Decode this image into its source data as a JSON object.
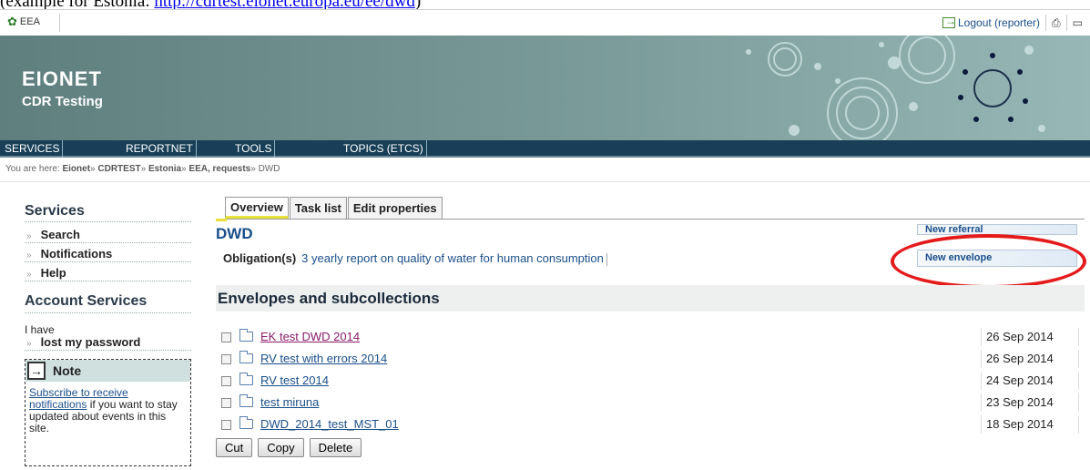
{
  "doc_caption": {
    "prefix": "(example for Estonia: ",
    "link": "http://cdrtest.eionet.europa.eu/ee/dwd",
    "suffix": ")"
  },
  "topbar": {
    "logo": "EEA",
    "logout": "Logout (reporter)",
    "icons": [
      "logout-icon",
      "print-icon",
      "fullscreen-icon"
    ]
  },
  "banner": {
    "brand": "EIONET",
    "subtitle": "CDR Testing"
  },
  "nav": [
    "SERVICES",
    "REPORTNET",
    "TOOLS",
    "TOPICS (ETCS)"
  ],
  "breadcrumb": {
    "prefix": "You are here:",
    "items": [
      "Eionet",
      "CDRTEST",
      "Estonia",
      "EEA, requests",
      "DWD"
    ]
  },
  "left": {
    "services_heading": "Services",
    "services": [
      "Search",
      "Notifications",
      "Help"
    ],
    "account_heading": "Account Services",
    "i_have": "I have",
    "lost_password": "lost my password",
    "note": {
      "title": "Note",
      "link": "Subscribe to receive notifications",
      "text": " if you want to stay updated about events in this site."
    }
  },
  "tabs": [
    "Overview",
    "Task list",
    "Edit properties"
  ],
  "main": {
    "title": "DWD",
    "obligation_label": "Obligation(s)",
    "obligation_link": "3 yearly report on quality of water for human consumption",
    "new_referral": "New referral",
    "new_envelope": "New envelope",
    "section_title": "Envelopes and subcollections"
  },
  "envelopes": [
    {
      "name": "EK test DWD 2014",
      "date": "26 Sep 2014",
      "visited": true
    },
    {
      "name": "RV test with errors 2014",
      "date": "26 Sep 2014",
      "visited": false
    },
    {
      "name": "RV test 2014",
      "date": "24 Sep 2014",
      "visited": false
    },
    {
      "name": "test miruna",
      "date": "23 Sep 2014",
      "visited": false
    },
    {
      "name": "DWD_2014_test_MST_01",
      "date": "18 Sep 2014",
      "visited": false
    }
  ],
  "actions": [
    "Cut",
    "Copy",
    "Delete"
  ],
  "colors": {
    "nav_bg": "#183f57",
    "link": "#1a4e8a",
    "highlight": "#e51b1b",
    "active_tab_accent": "#e8e13c"
  }
}
